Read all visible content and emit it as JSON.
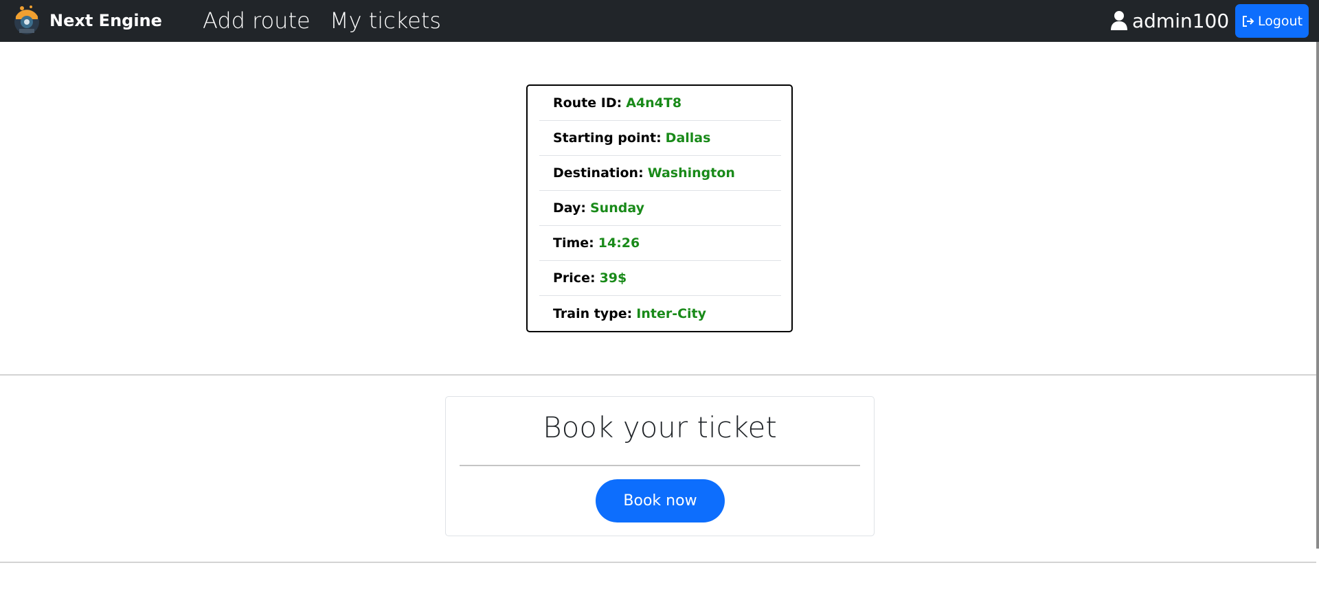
{
  "navbar": {
    "brand": "Next Engine",
    "brand_icon": "locomotive-logo-icon",
    "links": [
      "Add route",
      "My tickets"
    ],
    "username": "admin100",
    "user_icon": "user-icon",
    "logout_label": "Logout",
    "logout_icon": "logout-arrow-icon",
    "accent_color": "#0d6efd"
  },
  "route": {
    "rows": [
      {
        "label": "Route ID:",
        "value": "A4n4T8"
      },
      {
        "label": "Starting point:",
        "value": "Dallas"
      },
      {
        "label": "Destination:",
        "value": "Washington"
      },
      {
        "label": "Day:",
        "value": "Sunday"
      },
      {
        "label": "Time:",
        "value": "14:26"
      },
      {
        "label": "Price:",
        "value": "39$"
      },
      {
        "label": "Train type:",
        "value": "Inter-City"
      }
    ],
    "value_color": "#198a19"
  },
  "booking": {
    "title": "Book your ticket",
    "button_label": "Book now"
  }
}
